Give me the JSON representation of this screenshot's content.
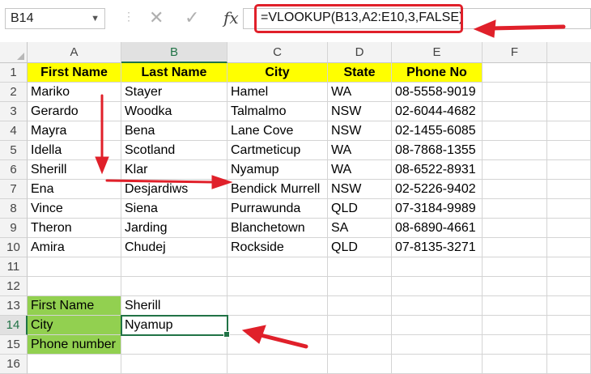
{
  "formula_bar": {
    "name_box": "B14",
    "cancel_icon": "✕",
    "enter_icon": "✓",
    "fx_label": "fx",
    "formula": "=VLOOKUP(B13,A2:E10,3,FALSE)"
  },
  "columns": [
    "A",
    "B",
    "C",
    "D",
    "E",
    "F"
  ],
  "rows": [
    "1",
    "2",
    "3",
    "4",
    "5",
    "6",
    "7",
    "8",
    "9",
    "10",
    "11",
    "12",
    "13",
    "14",
    "15",
    "16"
  ],
  "table": {
    "headers": [
      "First Name",
      "Last Name",
      "City",
      "State",
      "Phone No"
    ],
    "data": [
      [
        "Mariko",
        "Stayer",
        "Hamel",
        "WA",
        "08-5558-9019"
      ],
      [
        "Gerardo",
        "Woodka",
        "Talmalmo",
        "NSW",
        "02-6044-4682"
      ],
      [
        "Mayra",
        "Bena",
        "Lane Cove",
        "NSW",
        "02-1455-6085"
      ],
      [
        "Idella",
        "Scotland",
        "Cartmeticup",
        "WA",
        "08-7868-1355"
      ],
      [
        "Sherill",
        "Klar",
        "Nyamup",
        "WA",
        "08-6522-8931"
      ],
      [
        "Ena",
        "Desjardiws",
        "Bendick Murrell",
        "NSW",
        "02-5226-9402"
      ],
      [
        "Vince",
        "Siena",
        "Purrawunda",
        "QLD",
        "07-3184-9989"
      ],
      [
        "Theron",
        "Jarding",
        "Blanchetown",
        "SA",
        "08-6890-4661"
      ],
      [
        "Amira",
        "Chudej",
        "Rockside",
        "QLD",
        "07-8135-3271"
      ]
    ]
  },
  "lookup": {
    "labels": [
      "First Name",
      "City",
      "Phone number"
    ],
    "values": [
      "Sherill",
      "Nyamup",
      ""
    ]
  },
  "colors": {
    "header_fill": "#ffff00",
    "label_fill": "#92d050",
    "selection": "#217346",
    "annotation": "#e0202a"
  }
}
